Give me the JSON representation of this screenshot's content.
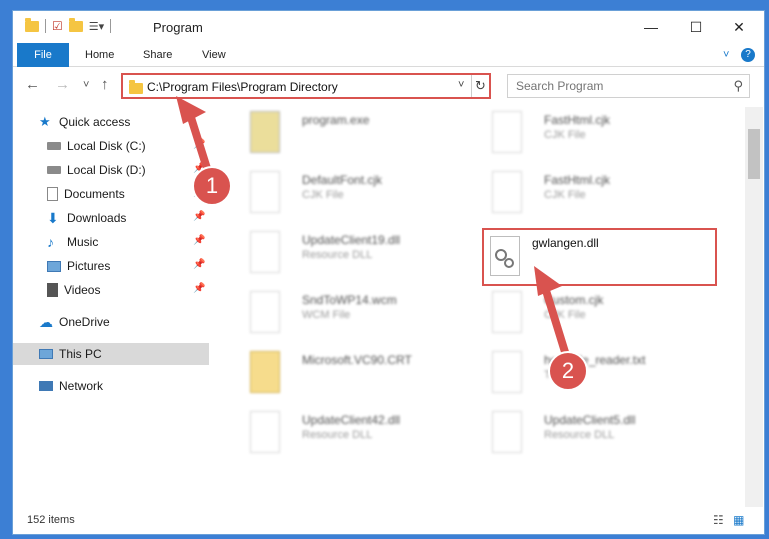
{
  "window": {
    "title": "Program",
    "controls": {
      "minimize": "—",
      "maximize": "☐",
      "close": "✕"
    }
  },
  "ribbon": {
    "tabs": [
      "File",
      "Home",
      "Share",
      "View"
    ],
    "collapse": "˅",
    "help": "?"
  },
  "nav": {
    "back": "←",
    "forward": "→",
    "recent": "˅",
    "up": "↑"
  },
  "address": {
    "path": "C:\\Program Files\\Program Directory",
    "dropdown": "˅",
    "refresh": "↻"
  },
  "search": {
    "placeholder": "Search Program"
  },
  "sidebar": {
    "items": [
      {
        "label": "Quick access",
        "icon": "star-icon",
        "pinned": false
      },
      {
        "label": "Local Disk (C:)",
        "icon": "drive-icon",
        "pinned": true
      },
      {
        "label": "Local Disk (D:)",
        "icon": "drive-icon",
        "pinned": true
      },
      {
        "label": "Documents",
        "icon": "document-icon",
        "pinned": true
      },
      {
        "label": "Downloads",
        "icon": "download-icon",
        "pinned": true
      },
      {
        "label": "Music",
        "icon": "music-icon",
        "pinned": true
      },
      {
        "label": "Pictures",
        "icon": "picture-icon",
        "pinned": true
      },
      {
        "label": "Videos",
        "icon": "video-icon",
        "pinned": true
      },
      {
        "label": "OneDrive",
        "icon": "cloud-icon",
        "pinned": false
      },
      {
        "label": "This PC",
        "icon": "computer-icon",
        "pinned": false,
        "selected": true
      },
      {
        "label": "Network",
        "icon": "network-icon",
        "pinned": false
      }
    ],
    "pin_glyph": "📌"
  },
  "files": [
    {
      "name": "program.exe",
      "type": ""
    },
    {
      "name": "FastHtml.cjk",
      "type": "CJK File"
    },
    {
      "name": "DefaultFont.cjk",
      "type": "CJK File"
    },
    {
      "name": "FastHtml.cjk",
      "type": "CJK File"
    },
    {
      "name": "UpdateClient19.dll",
      "type": "Resource DLL"
    },
    {
      "name": "SndToWP14.wcm",
      "type": "WCM File"
    },
    {
      "name": "Custom.cjk",
      "type": "CJK File"
    },
    {
      "name": "Microsoft.VC90.CRT",
      "type": ""
    },
    {
      "name": "help_file_reader.txt",
      "type": "TXT File"
    },
    {
      "name": "UpdateClient42.dll",
      "type": "Resource DLL"
    },
    {
      "name": "UpdateClient5.dll",
      "type": "Resource DLL"
    }
  ],
  "highlighted_file": {
    "name": "gwlangen.dll"
  },
  "status": {
    "count": "152 items",
    "details_view": "☷",
    "icons_view": "▦"
  },
  "annotations": {
    "step1": "1",
    "step2": "2"
  },
  "colors": {
    "accent": "#1979ca",
    "highlight": "#d9534f",
    "desktop": "#3c7fd4"
  }
}
